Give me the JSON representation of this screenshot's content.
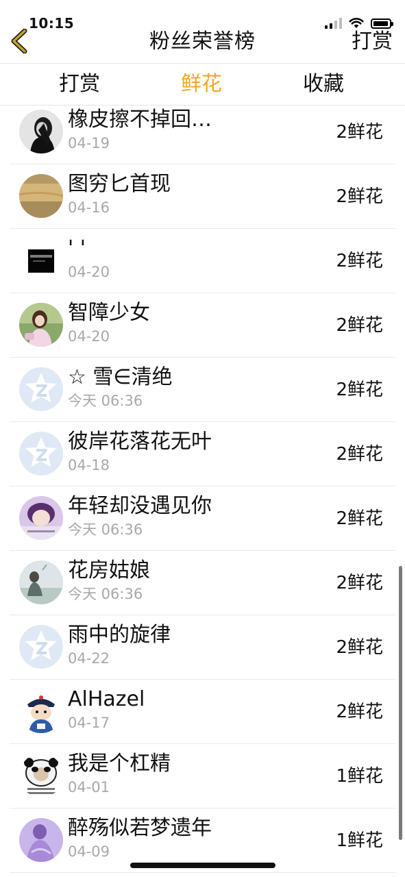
{
  "status_bar": {
    "time": "10:15"
  },
  "nav": {
    "title": "粉丝荣誉榜",
    "right_label": "打赏",
    "back_icon": "chevron-left-icon",
    "accent_color": "#f5a623"
  },
  "tabs": [
    {
      "label": "打赏",
      "active": false
    },
    {
      "label": "鲜花",
      "active": true
    },
    {
      "label": "收藏",
      "active": false
    }
  ],
  "fans": [
    {
      "name": "橡皮擦不掉回…",
      "time": "04-19",
      "count": "2鲜花",
      "avatar": "girl-dark-hair-avatar"
    },
    {
      "name": "图穷匕首现",
      "time": "04-16",
      "count": "2鲜花",
      "avatar": "wheat-field-avatar"
    },
    {
      "name": "' '",
      "time": "04-20",
      "count": "2鲜花",
      "avatar": "black-card-avatar"
    },
    {
      "name": "智障少女",
      "time": "04-20",
      "count": "2鲜花",
      "avatar": "girl-pink-avatar"
    },
    {
      "name": "☆ 雪∈清绝",
      "time": "今天 06:36",
      "count": "2鲜花",
      "avatar": "default-star-avatar"
    },
    {
      "name": "彼岸花落花无叶",
      "time": "04-18",
      "count": "2鲜花",
      "avatar": "default-star-avatar"
    },
    {
      "name": "年轻却没遇见你",
      "time": "今天 06:36",
      "count": "2鲜花",
      "avatar": "purple-boy-avatar"
    },
    {
      "name": "花房姑娘",
      "time": "今天 06:36",
      "count": "2鲜花",
      "avatar": "girl-field-avatar"
    },
    {
      "name": "雨中的旋律",
      "time": "04-22",
      "count": "2鲜花",
      "avatar": "default-star-avatar"
    },
    {
      "name": "AlHazel",
      "time": "04-17",
      "count": "2鲜花",
      "avatar": "cartoon-qing-avatar"
    },
    {
      "name": "我是个杠精",
      "time": "04-01",
      "count": "1鲜花",
      "avatar": "panda-meme-avatar"
    },
    {
      "name": "醉殇似若梦遗年",
      "time": "04-09",
      "count": "1鲜花",
      "avatar": "purple-dress-avatar"
    }
  ]
}
